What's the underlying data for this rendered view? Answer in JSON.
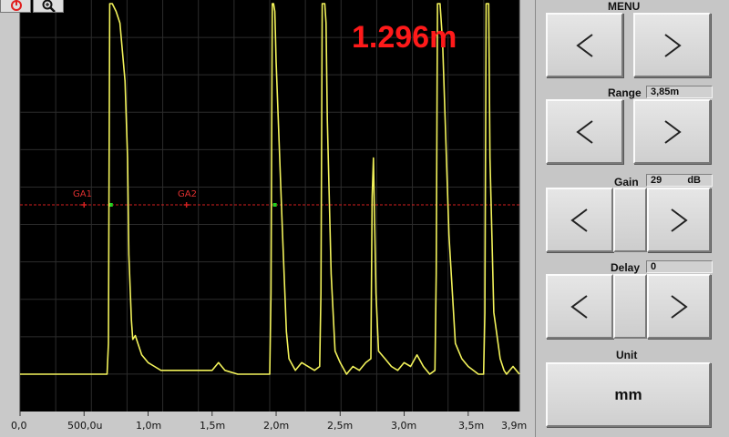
{
  "toolbar": {
    "buttons": [
      {
        "icon": "power-icon",
        "color": "#e02020"
      },
      {
        "icon": "zoom-icon",
        "color": "#111111"
      }
    ]
  },
  "readout": {
    "distance": "1.296m",
    "color": "#ff1a1a"
  },
  "gates": [
    {
      "label": "GA1",
      "x_m": 0.5
    },
    {
      "label": "GA2",
      "x_m": 1.3
    }
  ],
  "axis": {
    "ticks": [
      "0,0",
      "500,0u",
      "1,0m",
      "1,5m",
      "2,0m",
      "2,5m",
      "3,0m",
      "3,5m",
      "3,9m"
    ]
  },
  "panel": {
    "menu_label": "MENU",
    "range_label": "Range",
    "range_value": "3,85m",
    "gain_label": "Gain",
    "gain_value": "29",
    "gain_unit": "dB",
    "delay_label": "Delay",
    "delay_value": "0",
    "unit_label": "Unit",
    "unit_value": "mm",
    "prev_glyph": "<",
    "next_glyph": ">"
  },
  "colors": {
    "trace": "#f2f25a",
    "grid": "#2c2c2c",
    "gate_line": "#d42020",
    "gate_marker": "#20d020",
    "screen_bg": "#000000"
  },
  "chart_data": {
    "type": "line",
    "title": "",
    "xlabel": "",
    "ylabel": "",
    "xlim": [
      0,
      3.9
    ],
    "ylim": [
      0,
      100
    ],
    "grid": true,
    "series": [
      {
        "x": [
          0.0,
          0.3,
          0.6,
          0.68,
          0.69,
          0.7,
          0.71,
          0.72,
          0.75,
          0.78,
          0.82,
          0.84,
          0.85,
          0.87,
          0.88,
          0.9,
          0.92,
          0.95,
          1.0,
          1.05,
          1.1,
          1.2,
          1.3,
          1.4,
          1.5,
          1.55,
          1.6,
          1.7,
          1.8,
          1.9,
          1.95,
          1.96,
          1.97,
          1.98,
          1.99,
          2.0,
          2.05,
          2.08,
          2.1,
          2.15,
          2.2,
          2.3,
          2.34,
          2.35,
          2.36,
          2.37,
          2.38,
          2.39,
          2.4,
          2.43,
          2.46,
          2.5,
          2.55,
          2.6,
          2.65,
          2.7,
          2.74,
          2.75,
          2.76,
          2.78,
          2.8,
          2.85,
          2.9,
          2.95,
          3.0,
          3.05,
          3.1,
          3.15,
          3.2,
          3.24,
          3.25,
          3.26,
          3.27,
          3.28,
          3.3,
          3.35,
          3.4,
          3.45,
          3.5,
          3.58,
          3.62,
          3.63,
          3.64,
          3.65,
          3.66,
          3.67,
          3.7,
          3.75,
          3.78,
          3.8,
          3.85,
          3.9
        ],
        "y": [
          4,
          4,
          4,
          4,
          12,
          100,
          100,
          100,
          98,
          95,
          80,
          60,
          35,
          18,
          13,
          14,
          12,
          9,
          7,
          6,
          5,
          5,
          5,
          5,
          5,
          7,
          5,
          4,
          4,
          4,
          4,
          25,
          100,
          100,
          98,
          85,
          40,
          15,
          8,
          5,
          7,
          5,
          6,
          25,
          100,
          100,
          100,
          95,
          70,
          30,
          10,
          7,
          4,
          6,
          5,
          7,
          8,
          50,
          60,
          25,
          10,
          8,
          6,
          5,
          7,
          6,
          9,
          6,
          4,
          5,
          30,
          100,
          100,
          100,
          90,
          40,
          12,
          8,
          6,
          4,
          4,
          20,
          100,
          100,
          100,
          60,
          20,
          8,
          5,
          4,
          6,
          4
        ]
      }
    ],
    "tick_labels": [
      "0,0",
      "500,0u",
      "1,0m",
      "1,5m",
      "2,0m",
      "2,5m",
      "3,0m",
      "3,5m",
      "3,9m"
    ]
  }
}
